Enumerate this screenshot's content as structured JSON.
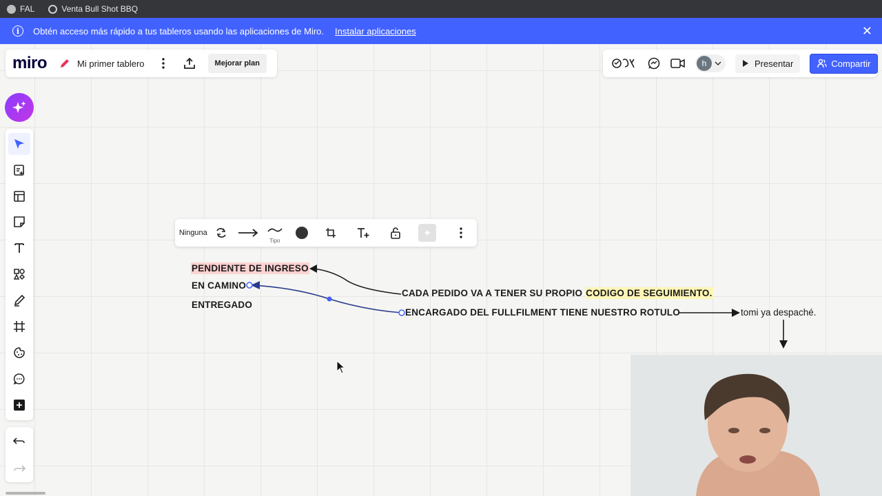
{
  "browser": {
    "bookmarks": [
      {
        "label": "FAL",
        "icon": "globe-icon"
      },
      {
        "label": "Venta Bull Shot BBQ",
        "icon": "openai-icon"
      }
    ]
  },
  "banner": {
    "message": "Obtén acceso más rápido a tus tableros usando las aplicaciones de Miro.",
    "link": "Instalar aplicaciones",
    "close": "✕"
  },
  "header": {
    "logo": "miro",
    "board_name": "Mi primer tablero",
    "upgrade_label": "Mejorar plan",
    "avatar_initial": "h",
    "present_label": "Presentar",
    "share_label": "Compartir"
  },
  "context_toolbar": {
    "none_label": "Ninguna",
    "type_label": "Tipo"
  },
  "board": {
    "status_pending": "PENDIENTE DE INGRESO",
    "status_on_the_way": "EN CAMINO",
    "status_delivered": "ENTREGADO",
    "note1_prefix": "CADA PEDIDO VA A TENER SU PROPIO ",
    "note1_highlight": "CODIGO DE SEGUIMIENTO.",
    "note2": "ENCARGADO DEL FULLFILMENT TIENE NUESTRO ROTULO",
    "note3": "tomi ya despaché."
  },
  "colors": {
    "accent": "#4262ff",
    "highlight_pink": "#ffd2d2",
    "highlight_yellow": "#fff6b6",
    "connector": "#2a3a8c"
  }
}
